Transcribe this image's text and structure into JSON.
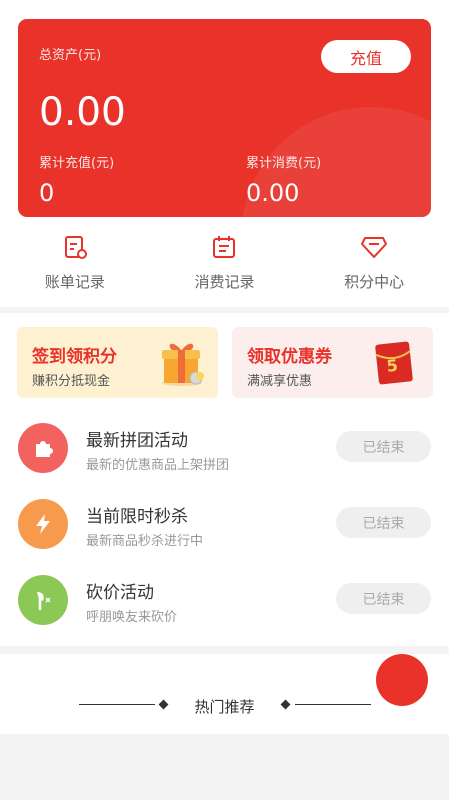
{
  "assets": {
    "total_label": "总资产(元)",
    "total_value": "0.00",
    "recharge_button": "充值",
    "accum_recharge_label": "累计充值(元)",
    "accum_recharge_value": "0",
    "accum_spend_label": "累计消费(元)",
    "accum_spend_value": "0.00"
  },
  "nav": [
    {
      "label": "账单记录",
      "icon": "bill-icon"
    },
    {
      "label": "消费记录",
      "icon": "calendar-icon"
    },
    {
      "label": "积分中心",
      "icon": "diamond-icon"
    }
  ],
  "promos": [
    {
      "title": "签到领积分",
      "subtitle": "赚积分抵现金",
      "icon": "gift-box-icon",
      "color": "#e8322a"
    },
    {
      "title": "领取优惠券",
      "subtitle": "满减享优惠",
      "icon": "red-envelope-icon",
      "badge": "5",
      "color": "#e8322a"
    }
  ],
  "activities": [
    {
      "title": "最新拼团活动",
      "subtitle": "最新的优惠商品上架拼团",
      "status": "已结束",
      "icon": "puzzle-icon",
      "color": "#f2625f"
    },
    {
      "title": "当前限时秒杀",
      "subtitle": "最新商品秒杀进行中",
      "status": "已结束",
      "icon": "lightning-icon",
      "color": "#f89a4e"
    },
    {
      "title": "砍价活动",
      "subtitle": "呼朋唤友来砍价",
      "status": "已结束",
      "icon": "axe-icon",
      "color": "#8cc856"
    }
  ],
  "hot_section": {
    "title": "热门推荐"
  },
  "colors": {
    "brand_red": "#e8322a",
    "disabled_bg": "#efefef"
  }
}
